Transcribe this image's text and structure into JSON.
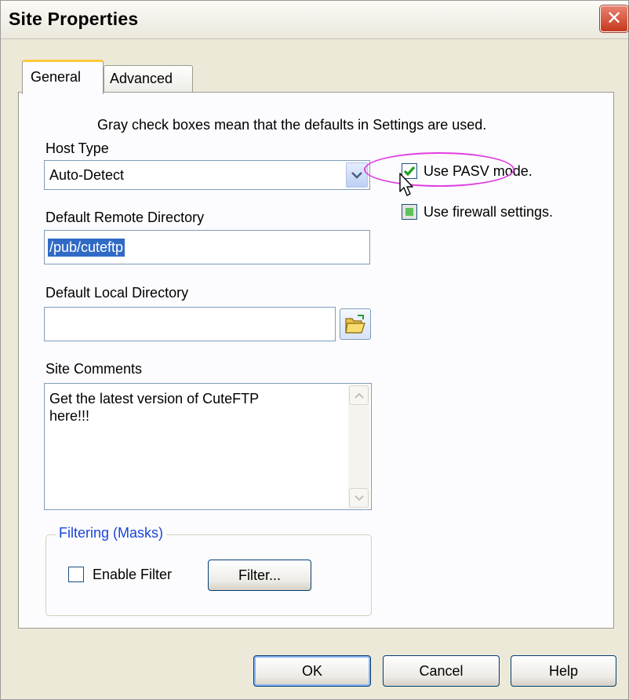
{
  "window": {
    "title": "Site Properties",
    "close_symbol": "✕"
  },
  "tabs": [
    {
      "label": "General",
      "active": true
    },
    {
      "label": "Advanced",
      "active": false
    }
  ],
  "general": {
    "notice": "Gray check boxes mean that the defaults in Settings are used.",
    "host_type": {
      "label": "Host Type",
      "value": "Auto-Detect",
      "arrow_icon": "chevron-down"
    },
    "pasv_mode": {
      "label": "Use PASV mode.",
      "checked": true
    },
    "firewall": {
      "label": "Use firewall settings.",
      "state": "indeterminate"
    },
    "remote_dir": {
      "label": "Default Remote Directory",
      "value": "/pub/cuteftp"
    },
    "local_dir": {
      "label": "Default Local Directory",
      "value": "",
      "browse_icon": "open-folder"
    },
    "comments": {
      "label": "Site Comments",
      "value": "Get the latest version of CuteFTP\nhere!!!"
    },
    "filtering": {
      "group_label": "Filtering (Masks)",
      "enable_label": "Enable Filter",
      "enabled": false,
      "filter_button": "Filter..."
    }
  },
  "buttons": {
    "ok": "OK",
    "cancel": "Cancel",
    "help": "Help"
  },
  "colors": {
    "dialog_bg": "#ece9d8",
    "panel_bg": "#fcfcfe",
    "accent_blue": "#1a46d6",
    "annotation": "#e040e0",
    "check_green": "#21a121"
  }
}
